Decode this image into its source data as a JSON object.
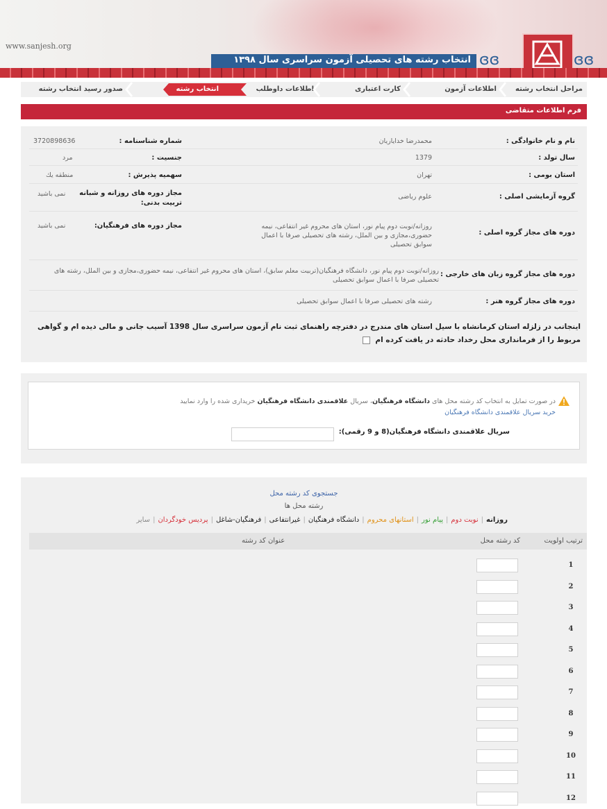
{
  "header": {
    "site_url": "www.sanjesh.org",
    "title": "انتخاب رشته های تحصیلی آزمون سراسری سال ۱۳۹۸"
  },
  "steps": [
    {
      "label": "مراحل انتخاب رشته"
    },
    {
      "label": "اطلاعات آزمون"
    },
    {
      "label": "کارت اعتباری"
    },
    {
      "label": "اطلاعات داوطلب"
    },
    {
      "label": "انتخاب رشته",
      "active": true
    },
    {
      "label": "صدور رسید انتخاب رشته"
    }
  ],
  "form_header": "فرم اطلاعات متقاضی",
  "applicant": {
    "name_label": "نام و نام خانوادگی :",
    "name_value": "محمدرضا خدایاریان",
    "id_label": "شماره شناسنامه :",
    "id_value": "3720898636",
    "birth_label": "سال تولد :",
    "birth_value": "1379",
    "gender_label": "جنسیت :",
    "gender_value": "مرد",
    "province_label": "استان بومی :",
    "province_value": "تهران",
    "quota_label": "سهمیه پذیرش :",
    "quota_value": "منطقه یك",
    "group_label": "گروه آزمایشی اصلی :",
    "group_value": "علوم ریاضی",
    "daynight_label": "مجاز دوره های روزانه و شبانه تربیت بدنی:",
    "daynight_value": "نمی باشید",
    "main_courses_label": "دوره های مجاز گروه اصلی :",
    "main_courses_value": "روزانه/نوبت دوم پیام نور، استان های محروم غیر انتفاعی، نیمه حضوری،مجازی و بین الملل، رشته های تحصیلی صرفا با اعمال سوابق تحصیلی",
    "farhangian_label": "مجاز دوره های فرهنگیان:",
    "farhangian_value": "نمی باشید",
    "lang_label": "دوره های مجاز گروه زبان های خارجی :",
    "lang_value": "روزانه/نوبت دوم پیام نور، دانشگاه فرهنگیان(تربیت معلم سابق)، استان های محروم غیر انتفاعی، نیمه حضوری،مجازی و بین الملل، رشته های تحصیلی صرفا با اعمال سوابق تحصیلی",
    "art_label": "دوره های مجاز گروه هنر :",
    "art_value": "رشته های تحصیلی صرفا با اعمال سوابق تحصیلی",
    "notice": "اینجانب در زلزله استان کرمانشاه با سیل استان های مندرج در دفترچه راهنمای ثبت نام آزمون سراسری سال 1398 آسیب جانی و مالی دیده ام و گواهی مربوط را از فرمانداری محل رخداد حادثه در یافت کرده ام"
  },
  "alert": {
    "text_part1": "در صورت تمایل به انتخاب کد رشته محل های",
    "bold1": "دانشگاه فرهنگیان",
    "text_part2": "، سریال",
    "bold2": "علاقمندی دانشگاه فرهنگیان",
    "text_part3": "خریداری شده را وارد نمایید",
    "buy_link": "خرید سریال علاقمندی دانشگاه فرهنگیان",
    "serial_label": "سریال علاقمندی دانشگاه فرهنگیان(8 و 9 رقمی):",
    "serial_value": ""
  },
  "majors": {
    "search_link": "جستجوی کد رشته محل",
    "subtitle": "رشته محل ها",
    "filters": [
      {
        "label": "روزانه",
        "color": "#222222"
      },
      {
        "label": "نوبت دوم",
        "color": "#d6303a"
      },
      {
        "label": "پیام نور",
        "color": "#3aa13a"
      },
      {
        "label": "استانهای محروم",
        "color": "#e0921a"
      },
      {
        "label": "دانشگاه فرهنگیان",
        "color": "#222222"
      },
      {
        "label": "غیرانتفاعی",
        "color": "#222222"
      },
      {
        "label": "فرهنگیان-شاغل",
        "color": "#222222"
      },
      {
        "label": "پردیس خودگردان",
        "color": "#d6303a"
      },
      {
        "label": "سایر",
        "color": "#888888"
      }
    ],
    "col_priority": "ترتیب اولویت",
    "col_code": "کد رشته محل",
    "col_title": "عنوان کد رشته",
    "rows": [
      "1",
      "2",
      "3",
      "4",
      "5",
      "6",
      "7",
      "8",
      "9",
      "10",
      "11",
      "12"
    ]
  }
}
